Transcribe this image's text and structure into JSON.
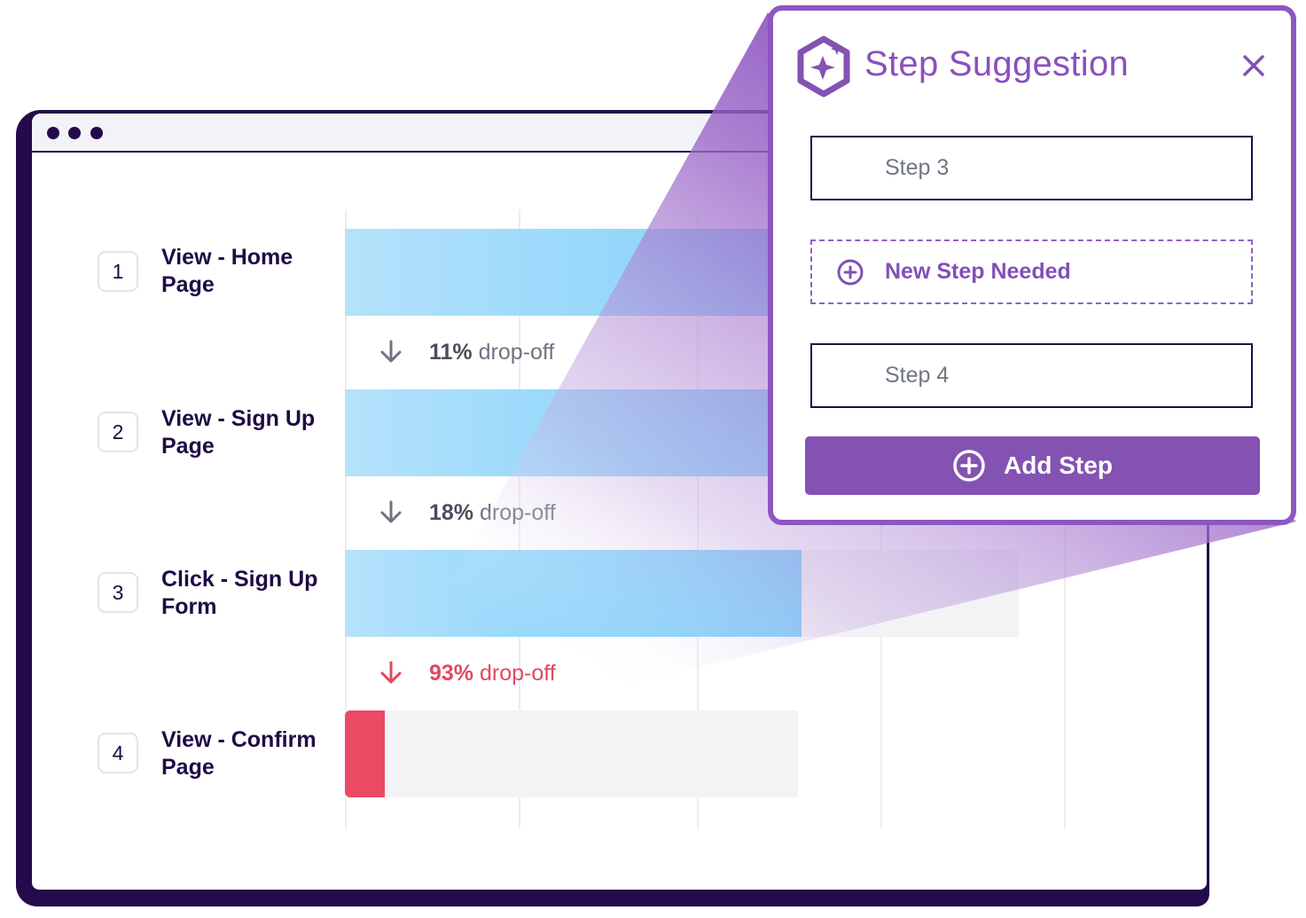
{
  "funnel": {
    "steps": [
      {
        "number": "1",
        "label": "View - Home Page",
        "conversion": 1.0
      },
      {
        "number": "2",
        "label": "View - Sign Up Page",
        "conversion": 0.89
      },
      {
        "number": "3",
        "label": "Click - Sign Up Form",
        "conversion": 0.73
      },
      {
        "number": "4",
        "label": "View - Confirm Page",
        "conversion": 0.05
      }
    ],
    "dropoffs": [
      {
        "percent": "11%",
        "text": " drop-off",
        "status": "normal"
      },
      {
        "percent": "18%",
        "text": " drop-off",
        "status": "normal"
      },
      {
        "percent": "93%",
        "text": " drop-off",
        "status": "critical"
      }
    ]
  },
  "popup": {
    "title": "Step Suggestion",
    "field_step_before": "Step 3",
    "suggestion_label": "New Step Needed",
    "field_step_after": "Step 4",
    "add_button_label": "Add Step"
  },
  "colors": {
    "window_frame": "#230a4a",
    "accent_purple": "#8352b3",
    "bar_blue": "#6dcafb",
    "alert_red": "#ea4a64"
  },
  "icons": [
    "step-suggestion-logo-icon",
    "close-icon",
    "add-circle-icon",
    "arrow-down-icon"
  ]
}
